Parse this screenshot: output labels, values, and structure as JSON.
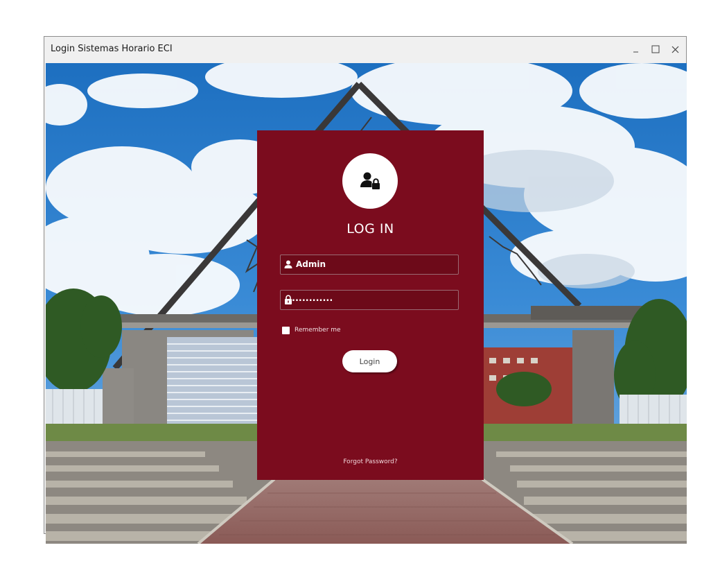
{
  "window": {
    "title": "Login Sistemas Horario ECI",
    "minimize_glyph": "_",
    "maximize_glyph": "☐",
    "close_glyph": "✕"
  },
  "background": {
    "icon": "campus-gate-photo"
  },
  "login": {
    "avatar_icon": "user-lock-icon",
    "title": "LOG IN",
    "username": {
      "icon": "user-icon",
      "value": "Admin"
    },
    "password": {
      "icon": "lock-icon",
      "value": "............"
    },
    "remember_label": "Remember me",
    "remember_checked": false,
    "login_button": "Login",
    "forgot_link": "Forgot Password?"
  },
  "colors": {
    "panel": "#7b0c1e",
    "accent_white": "#ffffff"
  }
}
